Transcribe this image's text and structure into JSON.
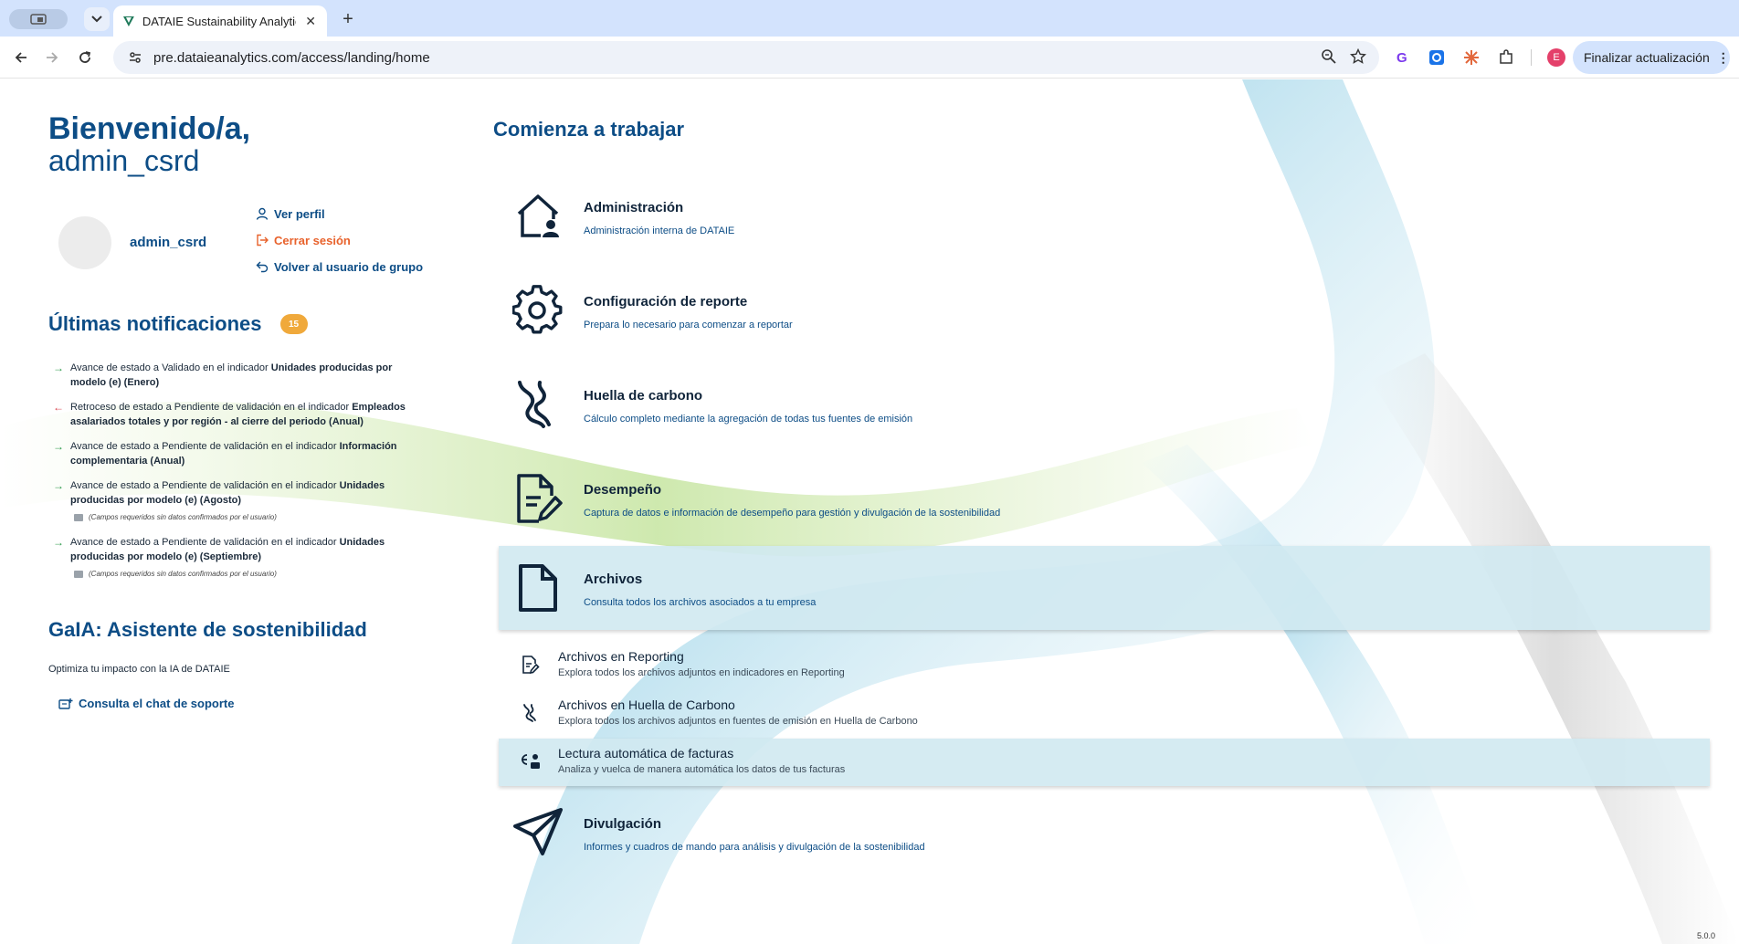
{
  "browser": {
    "tab_title": "DATAIE Sustainability Analytic",
    "url": "pre.dataieanalytics.com/access/landing/home",
    "update_button": "Finalizar actualización",
    "profile_initial": "E"
  },
  "welcome": {
    "line1": "Bienvenido/a,",
    "line2": "admin_csrd"
  },
  "profile": {
    "username": "admin_csrd",
    "view_profile": "Ver perfil",
    "logout": "Cerrar sesión",
    "back_to_group": "Volver al usuario de grupo"
  },
  "notifications": {
    "title": "Últimas notificaciones",
    "count": "15",
    "items": [
      {
        "direction": "forward",
        "text": "Avance de estado a Validado en el indicador ",
        "bold": "Unidades producidas por modelo (e) (Enero)",
        "note": ""
      },
      {
        "direction": "back",
        "text": "Retroceso de estado a Pendiente de validación en el indicador ",
        "bold": "Empleados asalariados totales y por región - al cierre del periodo (Anual)",
        "note": ""
      },
      {
        "direction": "forward",
        "text": "Avance de estado a Pendiente de validación en el indicador ",
        "bold": "Información complementaria (Anual)",
        "note": ""
      },
      {
        "direction": "forward",
        "text": "Avance de estado a Pendiente de validación en el indicador ",
        "bold": "Unidades producidas por modelo (e) (Agosto)",
        "note": "(Campos requeridos sin datos confirmados por el usuario)"
      },
      {
        "direction": "forward",
        "text": "Avance de estado a Pendiente de validación en el indicador ",
        "bold": "Unidades producidas por modelo (e) (Septiembre)",
        "note": "(Campos requeridos sin datos confirmados por el usuario)"
      }
    ]
  },
  "gaia": {
    "title": "GaIA: Asistente de sostenibilidad",
    "subtitle": "Optimiza tu impacto con la IA de DATAIE",
    "link": "Consulta el chat de soporte"
  },
  "start": {
    "title": "Comienza a trabajar",
    "modules": [
      {
        "icon": "house-user-icon",
        "title": "Administración",
        "desc": "Administración interna de DATAIE"
      },
      {
        "icon": "gear-icon",
        "title": "Configuración de reporte",
        "desc": "Prepara lo necesario para comenzar a reportar"
      },
      {
        "icon": "footprint-icon",
        "title": "Huella de carbono",
        "desc": "Cálculo completo mediante la agregación de todas tus fuentes de emisión"
      },
      {
        "icon": "document-edit-icon",
        "title": "Desempeño",
        "desc": "Captura de datos e información de desempeño para gestión y divulgación de la sostenibilidad"
      },
      {
        "icon": "file-icon",
        "title": "Archivos",
        "desc": "Consulta todos los archivos asociados a tu empresa"
      }
    ],
    "submodules": [
      {
        "icon": "document-edit-icon",
        "title": "Archivos en Reporting",
        "desc": "Explora todos los archivos adjuntos en indicadores en Reporting"
      },
      {
        "icon": "footprint-icon",
        "title": "Archivos en Huella de Carbono",
        "desc": "Explora todos los archivos adjuntos en fuentes de emisión en Huella de Carbono"
      },
      {
        "icon": "invoice-scan-icon",
        "title": "Lectura automática de facturas",
        "desc": "Analiza y vuelca de manera automática los datos de tus facturas"
      }
    ],
    "last_module": {
      "icon": "paper-plane-icon",
      "title": "Divulgación",
      "desc": "Informes y cuadros de mando para análisis y divulgación de la sostenibilidad"
    }
  },
  "version": "5.0.0"
}
